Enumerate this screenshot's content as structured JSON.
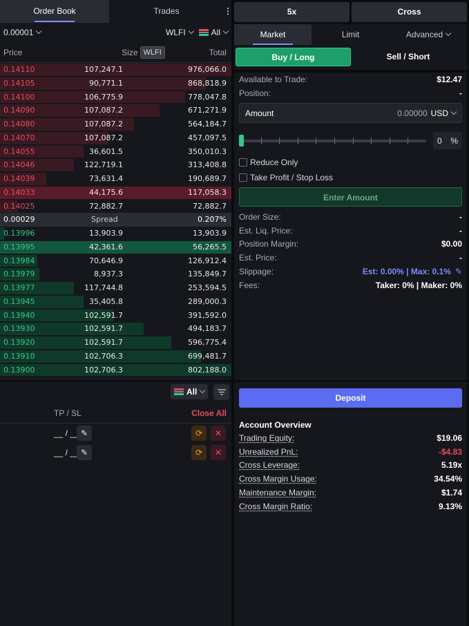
{
  "orderbook": {
    "tabs": [
      "Order Book",
      "Trades"
    ],
    "tick_size": "0.00001",
    "coin": "WLFI",
    "side_filter": "All",
    "col_price": "Price",
    "col_size": "Size",
    "col_size_unit": "WLFI",
    "col_total": "Total",
    "asks": [
      {
        "price": "0.14110",
        "size": "107,247.1",
        "total": "976,066.0",
        "depth": 1.0
      },
      {
        "price": "0.14105",
        "size": "90,771.1",
        "total": "868,818.9",
        "depth": 0.89
      },
      {
        "price": "0.14100",
        "size": "106,775.9",
        "total": "778,047.8",
        "depth": 0.8
      },
      {
        "price": "0.14090",
        "size": "107,087.2",
        "total": "671,271.9",
        "depth": 0.69
      },
      {
        "price": "0.14080",
        "size": "107,087.2",
        "total": "564,184.7",
        "depth": 0.58
      },
      {
        "price": "0.14070",
        "size": "107,087.2",
        "total": "457,097.5",
        "depth": 0.47
      },
      {
        "price": "0.14055",
        "size": "36,601.5",
        "total": "350,010.3",
        "depth": 0.36
      },
      {
        "price": "0.14046",
        "size": "122,719.1",
        "total": "313,408.8",
        "depth": 0.32
      },
      {
        "price": "0.14039",
        "size": "73,631.4",
        "total": "190,689.7",
        "depth": 0.2
      },
      {
        "price": "0.14033",
        "size": "44,175.6",
        "total": "117,058.3",
        "depth": 1.0,
        "highlight": true
      },
      {
        "price": "0.14025",
        "size": "72,882.7",
        "total": "72,882.7",
        "depth": 0.075
      }
    ],
    "spread": {
      "value": "0.00029",
      "label": "Spread",
      "percent": "0.207%"
    },
    "bids": [
      {
        "price": "0.13996",
        "size": "13,903.9",
        "total": "13,903.9",
        "depth": 0.017
      },
      {
        "price": "0.13995",
        "size": "42,361.6",
        "total": "56,265.5",
        "depth": 1.0,
        "highlight": true
      },
      {
        "price": "0.13984",
        "size": "70,646.9",
        "total": "126,912.4",
        "depth": 0.16
      },
      {
        "price": "0.13979",
        "size": "8,937.3",
        "total": "135,849.7",
        "depth": 0.17
      },
      {
        "price": "0.13977",
        "size": "117,744.8",
        "total": "253,594.5",
        "depth": 0.32
      },
      {
        "price": "0.13945",
        "size": "35,405.8",
        "total": "289,000.3",
        "depth": 0.36
      },
      {
        "price": "0.13940",
        "size": "102,591.7",
        "total": "391,592.0",
        "depth": 0.49
      },
      {
        "price": "0.13930",
        "size": "102,591.7",
        "total": "494,183.7",
        "depth": 0.62
      },
      {
        "price": "0.13920",
        "size": "102,591.7",
        "total": "596,775.4",
        "depth": 0.74
      },
      {
        "price": "0.13910",
        "size": "102,706.3",
        "total": "699,481.7",
        "depth": 0.87
      },
      {
        "price": "0.13900",
        "size": "102,706.3",
        "total": "802,188.0",
        "depth": 1.0
      }
    ]
  },
  "positions": {
    "filter": "All",
    "col_tpsl": "TP / SL",
    "close_all": "Close All",
    "rows": [
      {
        "tpsl": "__ / __"
      },
      {
        "tpsl": "__ / __"
      }
    ]
  },
  "order": {
    "leverage": "5x",
    "margin_mode": "Cross",
    "tabs": [
      "Market",
      "Limit",
      "Advanced"
    ],
    "buy_label": "Buy / Long",
    "sell_label": "Sell / Short",
    "available_label": "Available to Trade:",
    "available_value": "$12.47",
    "position_label": "Position:",
    "position_value": "-",
    "amount_label": "Amount",
    "amount_value": "0.00000",
    "amount_unit": "USD",
    "slider_percent": "0",
    "slider_pct_sign": "%",
    "reduce_only": "Reduce Only",
    "tpsl": "Take Profit / Stop Loss",
    "submit_label": "Enter Amount",
    "order_size_label": "Order Size:",
    "order_size_value": "-",
    "liq_label": "Est. Liq. Price:",
    "liq_value": "-",
    "margin_label": "Position Margin:",
    "margin_value": "$0.00",
    "est_price_label": "Est. Price:",
    "est_price_value": "-",
    "slippage_label": "Slippage:",
    "slippage_value": "Est: 0.00% | Max: 0.1%",
    "fees_label": "Fees:",
    "fees_value": "Taker: 0% | Maker: 0%"
  },
  "account": {
    "deposit_label": "Deposit",
    "title": "Account Overview",
    "rows": [
      {
        "label": "Trading Equity:",
        "value": "$19.06"
      },
      {
        "label": "Unrealized PnL:",
        "value": "-$4.83"
      },
      {
        "label": "Cross Leverage:",
        "value": "5.19x"
      },
      {
        "label": "Cross Margin Usage:",
        "value": "34.54%"
      },
      {
        "label": "Maintenance Margin:",
        "value": "$1.74"
      },
      {
        "label": "Cross Margin Ratio:",
        "value": "9.13%"
      }
    ]
  },
  "colors": {
    "ask_bar": "#3a1a22",
    "ask_highlight": "#5a1c28",
    "bid_bar": "#0f3a2a",
    "bid_highlight": "#13573e",
    "buy_button": "#1e9e6b",
    "deposit_button": "#5b6cf0",
    "negative": "#e84a5f"
  }
}
